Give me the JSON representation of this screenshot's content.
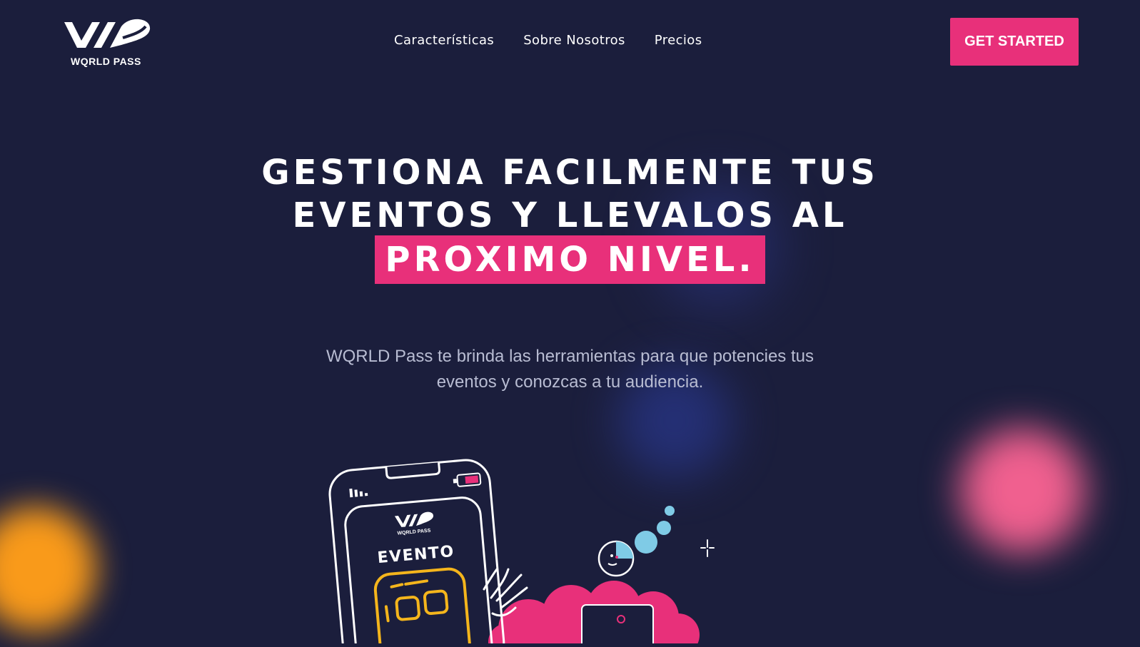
{
  "brand": {
    "logo_text": "WQRLD PASS"
  },
  "nav": {
    "items": [
      {
        "label": "Características"
      },
      {
        "label": "Sobre Nosotros"
      },
      {
        "label": "Precios"
      }
    ]
  },
  "cta": {
    "label": "GET STARTED"
  },
  "hero": {
    "title_line1": "GESTIONA FACILMENTE TUS",
    "title_line2": "EVENTOS Y LLEVALOS AL",
    "title_highlight": "PROXIMO NIVEL."
  },
  "subtitle": {
    "line1": "WQRLD Pass te brinda las herramientas para que potencies tus",
    "line2": "eventos y conozcas a tu audiencia."
  },
  "illustration": {
    "phone_logo_text": "WQRLD PASS",
    "phone_event_label": "EVENTO"
  },
  "colors": {
    "background": "#1b1e3c",
    "accent_pink": "#e8307a",
    "qr_yellow": "#f4b51c",
    "bubble_blue": "#7fcbe6",
    "blob_orange": "#f99a1a",
    "blob_pink": "#f0608f",
    "blob_navy": "#283074"
  },
  "icons": [
    "logo-mark-icon",
    "sparkle-icon",
    "battery-icon",
    "signal-icon",
    "qr-code-icon"
  ]
}
